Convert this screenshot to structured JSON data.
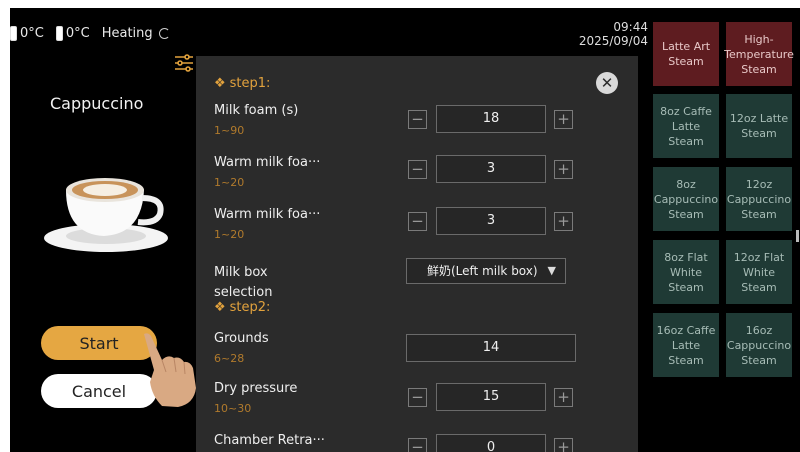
{
  "status": {
    "temp1": "0°C",
    "temp2": "0°C",
    "heating_label": "Heating",
    "time": "09:44",
    "date": "2025/09/04"
  },
  "left": {
    "drink_name": "Cappuccino",
    "start_label": "Start",
    "cancel_label": "Cancel"
  },
  "panel": {
    "close_glyph": "✕",
    "step_symbol": "❖",
    "step1": "step1:",
    "step2": "step2:",
    "minus": "−",
    "plus": "+",
    "rows": [
      {
        "label": "Milk foam (s)",
        "range": "1~90",
        "value": "18"
      },
      {
        "label": "Warm milk foa···",
        "range": "1~20",
        "value": "3"
      },
      {
        "label": "Warm milk foa···",
        "range": "1~20",
        "value": "3"
      },
      {
        "label": "Grounds",
        "range": "6~28",
        "value": "14"
      },
      {
        "label": "Dry pressure",
        "range": "10~30",
        "value": "15"
      },
      {
        "label": "Chamber Retra···",
        "value": "0"
      }
    ],
    "milk_box": {
      "label_line1": "Milk box",
      "label_line2": "selection",
      "value": "鲜奶(Left milk box)",
      "arrow": "▼"
    }
  },
  "tiles": [
    [
      "Latte Art",
      "Steam"
    ],
    [
      "High-",
      "Temperature",
      "Steam"
    ],
    [
      "8oz Caffe",
      "Latte",
      "Steam"
    ],
    [
      "12oz Latte",
      "Steam"
    ],
    [
      "8oz",
      "Cappuccino",
      "Steam"
    ],
    [
      "12oz",
      "Cappuccino",
      "Steam"
    ],
    [
      "8oz Flat",
      "White",
      "Steam"
    ],
    [
      "12oz Flat",
      "White",
      "Steam"
    ],
    [
      "16oz Caffe",
      "Latte",
      "Steam"
    ],
    [
      "16oz",
      "Cappuccino",
      "Steam"
    ]
  ],
  "colors": {
    "accent": "#e5a742",
    "panel_bg": "#2b2b2b",
    "tile_green": "#1f3a35",
    "tile_red": "#5e1c20"
  }
}
